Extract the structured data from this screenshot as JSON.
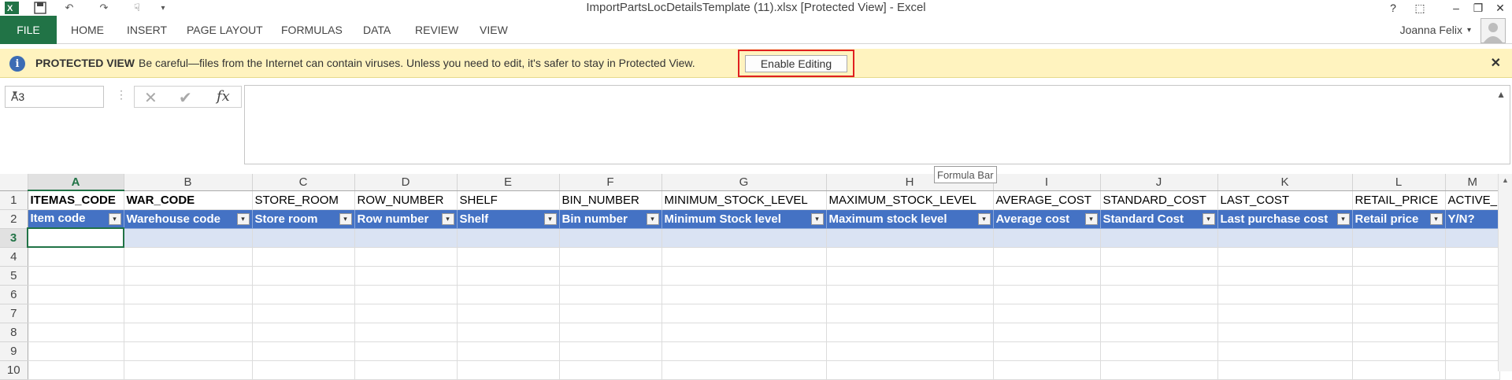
{
  "window": {
    "title": "ImportPartsLocDetailsTemplate (11).xlsx  [Protected View] - Excel",
    "controls": [
      "?",
      "⬚",
      "–",
      "❐",
      "✕"
    ]
  },
  "ribbon": {
    "tabs": [
      "FILE",
      "HOME",
      "INSERT",
      "PAGE LAYOUT",
      "FORMULAS",
      "DATA",
      "REVIEW",
      "VIEW"
    ],
    "user_name": "Joanna Felix"
  },
  "protected_view": {
    "label": "PROTECTED VIEW",
    "message": "Be careful—files from the Internet can contain viruses. Unless you need to edit, it's safer to stay in Protected View.",
    "button": "Enable Editing",
    "close": "✕"
  },
  "formula_bar": {
    "name_box": "A3",
    "cancel_symbol": "✕",
    "enter_symbol": "✔",
    "fx_label": "fx",
    "content": "",
    "tooltip": "Formula Bar"
  },
  "sheet": {
    "columns": [
      "A",
      "B",
      "C",
      "D",
      "E",
      "F",
      "G",
      "H",
      "I",
      "J",
      "K",
      "L",
      "M"
    ],
    "selected_column": "A",
    "selected_row": "3",
    "row_numbers": [
      "1",
      "2",
      "3",
      "4",
      "5",
      "6",
      "7",
      "8",
      "9",
      "10"
    ],
    "row1": [
      "ITEMAS_CODE",
      "WAR_CODE",
      "STORE_ROOM",
      "ROW_NUMBER",
      "SHELF",
      "BIN_NUMBER",
      "MINIMUM_STOCK_LEVEL",
      "MAXIMUM_STOCK_LEVEL",
      "AVERAGE_COST",
      "STANDARD_COST",
      "LAST_COST",
      "RETAIL_PRICE",
      "ACTIVE_"
    ],
    "row2": [
      "Item code",
      "Warehouse code",
      "Store room",
      "Row number",
      "Shelf",
      "Bin number",
      "Minimum Stock level",
      "Maximum stock level",
      "Average cost",
      "Standard Cost",
      "Last purchase cost",
      "Retail price",
      "Y/N?"
    ],
    "filter_glyph": "▾"
  },
  "colors": {
    "excel_green": "#217346",
    "header_row_blue": "#4472c4",
    "selected_row_tint": "#dae3f3",
    "protected_bar": "#fff3bf",
    "highlight_red": "#e02020"
  }
}
